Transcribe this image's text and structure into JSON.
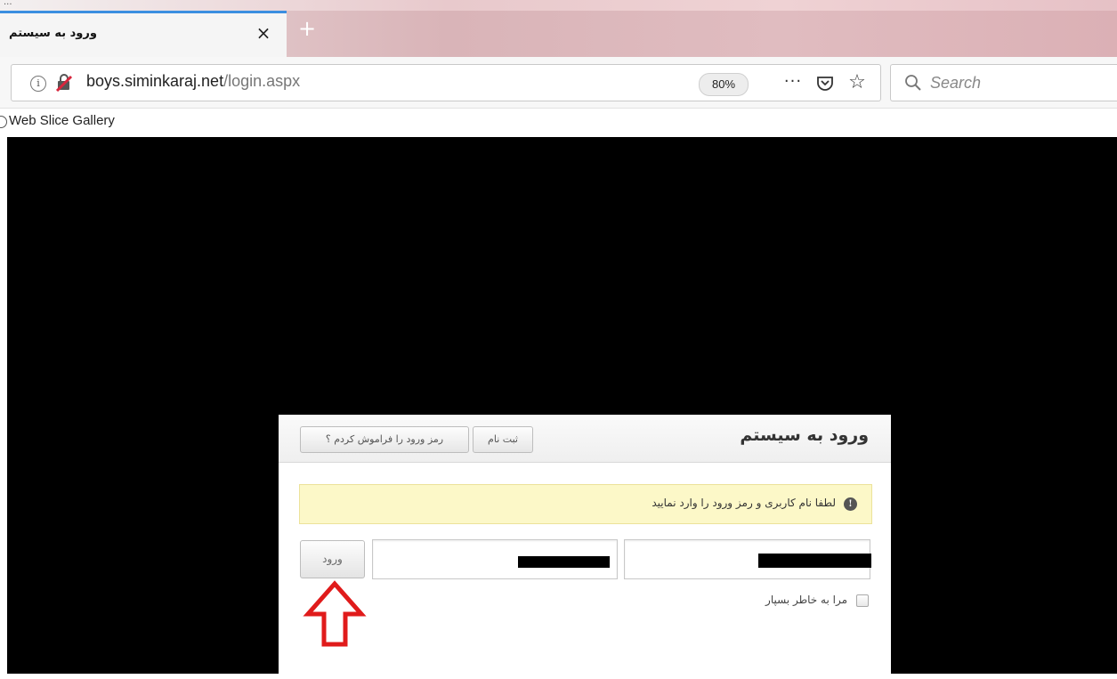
{
  "browser": {
    "top_fragment": "...",
    "tab": {
      "title": "ورود به سیستم",
      "close_glyph": "×"
    },
    "new_tab_glyph": "+",
    "site_info_glyph": "i",
    "url": {
      "domain": "boys.siminkaraj.net",
      "path": "/login.aspx"
    },
    "zoom": "80%",
    "page_actions_glyph": "···",
    "star_glyph": "☆",
    "search_placeholder": "Search",
    "bookmarks": [
      {
        "label": "Web Slice Gallery"
      }
    ]
  },
  "login": {
    "title": "ورود به سیستم",
    "register_label": "ثبت نام",
    "forgot_label": "رمز ورود را فراموش کردم ؟",
    "alert_icon_glyph": "!",
    "alert_text": "لطفا نام کاربری و رمز ورود را وارد نمایید",
    "username_value": "",
    "password_value": "",
    "submit_label": "ورود",
    "remember_label": "مرا به خاطر بسپار",
    "remember_checked": false
  },
  "colors": {
    "tab_accent": "#3b8fe0",
    "alert_bg": "#fcf8c8",
    "annotation_arrow": "#e01b1b",
    "page_bg": "#000000"
  },
  "icons": [
    "site-info-icon",
    "insecure-lock-icon",
    "page-actions-icon",
    "pocket-icon",
    "star-icon",
    "search-icon",
    "web-slice-icon",
    "info-icon",
    "checkbox-icon",
    "arrow-up-annotation"
  ]
}
